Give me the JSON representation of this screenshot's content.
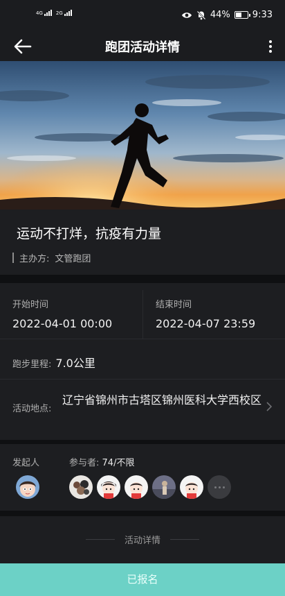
{
  "status_bar": {
    "signal_1_net": "4G",
    "signal_2_net": "2G",
    "battery_text": "44%",
    "battery_level": 0.44,
    "time": "9:33",
    "icons": [
      "signal-icon",
      "eye-icon",
      "mute-icon",
      "battery-icon"
    ]
  },
  "header": {
    "title": "跑团活动详情",
    "back_icon": "arrow-left-icon",
    "more_icon": "more-vertical-icon"
  },
  "activity": {
    "title": "运动不打烊，抗疫有力量",
    "organizer_label": "主办方:",
    "organizer": "文管跑团"
  },
  "schedule": {
    "start_label": "开始时间",
    "start_value": "2022-04-01 00:00",
    "end_label": "结束时间",
    "end_value": "2022-04-07 23:59",
    "distance_label": "跑步里程:",
    "distance_value": "7.0公里",
    "location_label": "活动地点:",
    "location_value": "辽宁省锦州市古塔区锦州医科大学西校区"
  },
  "people": {
    "initiator_label": "发起人",
    "participants_label": "参与者:",
    "participants_count": "74/不限"
  },
  "details": {
    "section_title": "活动详情"
  },
  "cta": {
    "label": "已报名"
  },
  "colors": {
    "background": "#141518",
    "card": "#1d1e21",
    "accent": "#6cd1c6"
  }
}
